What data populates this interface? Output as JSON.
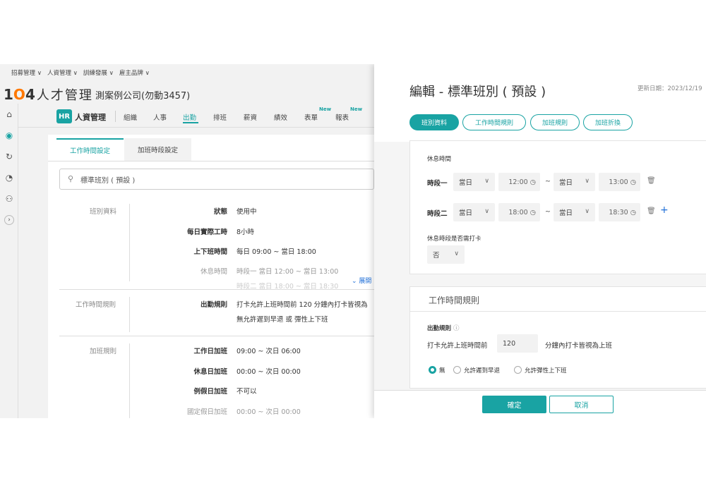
{
  "top_menu": [
    "招募管理",
    "人資管理",
    "訓練發展",
    "雇主品牌"
  ],
  "logo": {
    "prefix": "1",
    "o": "O",
    "suffix": "4",
    "text": "人才管理"
  },
  "company": "測案例公司(勿動3457)",
  "sidebar_icons": [
    "home-icon",
    "hr-circle-icon",
    "refresh-icon",
    "chart-icon",
    "people-icon",
    "chevron-right-icon"
  ],
  "nav": {
    "badge": "HR",
    "title": "人資管理",
    "items": [
      "組織",
      "人事",
      "出勤",
      "排班",
      "薪資",
      "績效",
      "表單",
      "報表"
    ],
    "active": "出勤",
    "new_label": "New"
  },
  "tabs": [
    "工作時間設定",
    "加班時段設定"
  ],
  "search_text": "標準班別 ( 預設 )",
  "left_sections": {
    "basic": {
      "label": "班別資料",
      "rows": [
        {
          "label": "狀態",
          "value": "使用中"
        },
        {
          "label": "每日實際工時",
          "value": "8小時"
        },
        {
          "label": "上下班時間",
          "value": "每日 09:00 ~ 當日 18:00"
        },
        {
          "label": "休息時間",
          "value": "時段一 當日 12:00 ~ 當日 13:00"
        },
        {
          "label": "",
          "value": "時段二 當日 18:00 ~ 當日 18:30"
        }
      ],
      "expand": "展開"
    },
    "work_rules": {
      "label": "工作時間規則",
      "row_label": "出勤規則",
      "line1": "打卡允許上班時間前 120 分鐘內打卡皆視為",
      "line2": "無允許遲到早退 或 彈性上下班"
    },
    "overtime": {
      "label": "加班規則",
      "rows": [
        {
          "label": "工作日加班",
          "value": "09:00 ~ 次日 06:00"
        },
        {
          "label": "休息日加班",
          "value": "00:00 ~ 次日 00:00"
        },
        {
          "label": "例假日加班",
          "value": "不可以"
        },
        {
          "label": "國定假日加班",
          "value": "00:00 ~ 次日 00:00"
        }
      ]
    }
  },
  "modal": {
    "title": "編輯 - 標準班別 ( 預設 )",
    "updated": "更新日期：2023/12/19",
    "pills": [
      "班別資料",
      "工作時間規則",
      "加班規則",
      "加班折換"
    ],
    "break": {
      "title": "休息時間",
      "slots": [
        {
          "label": "時段一",
          "start_day": "當日",
          "start_time": "12:00",
          "end_day": "當日",
          "end_time": "13:00"
        },
        {
          "label": "時段二",
          "start_day": "當日",
          "start_time": "18:00",
          "end_day": "當日",
          "end_time": "18:30"
        }
      ],
      "punch_question": "休息時段是否需打卡",
      "punch_value": "否"
    },
    "work_rules": {
      "title": "工作時間規則",
      "rule_label": "出勤規則",
      "prefix": "打卡允許上班時間前",
      "minutes": "120",
      "suffix": "分鐘內打卡皆視為上班",
      "options": [
        "無",
        "允許遲到早退",
        "允許彈性上下班"
      ],
      "selected": "無"
    },
    "ok": "確定",
    "cancel": "取消"
  },
  "colors": {
    "accent": "#19a3a3",
    "link": "#1f6fd8",
    "brand_orange": "#ff7800"
  }
}
